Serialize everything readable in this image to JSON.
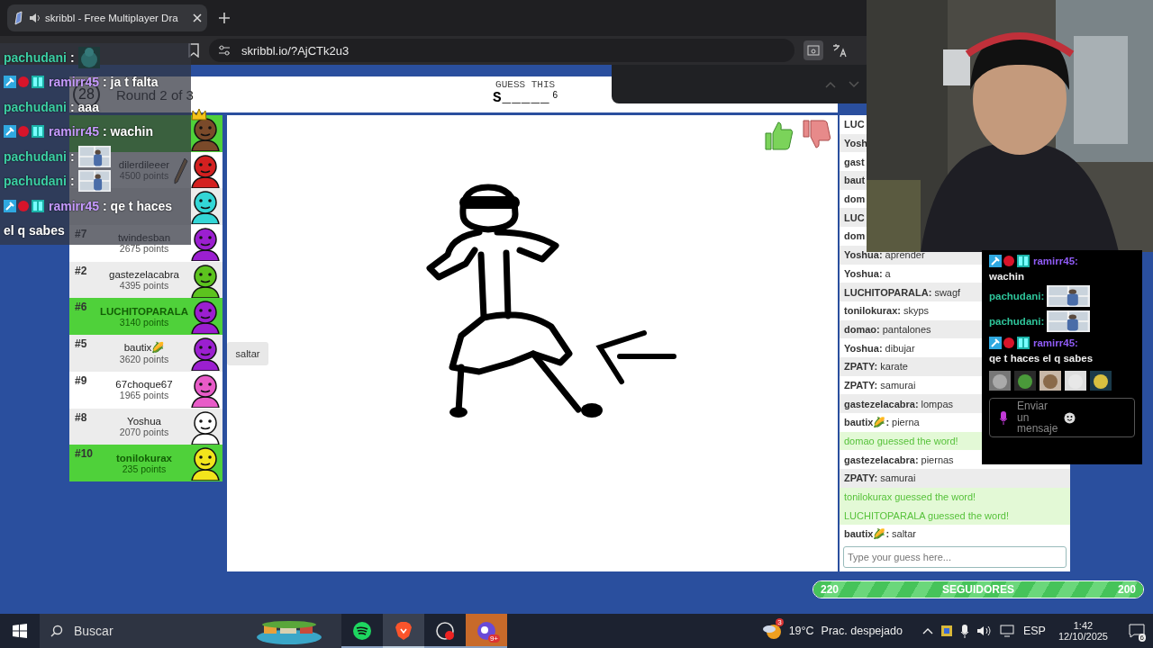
{
  "browser": {
    "tab": {
      "title": "skribbl - Free Multiplayer Dra",
      "selected": true
    },
    "url": "skribbl.io/?AjCTk2u3"
  },
  "stream_chat": [
    {
      "kind": "emote",
      "author": "pachudani",
      "badges": false,
      "text": ":"
    },
    {
      "kind": "text",
      "author": "ramirr45",
      "badges": true,
      "text": ": ja t falta"
    },
    {
      "kind": "text",
      "author": "pachudani",
      "badges": false,
      "text": ": aaa"
    },
    {
      "kind": "text",
      "author": "ramirr45",
      "badges": true,
      "text": ": wachin"
    },
    {
      "author": "pachudani",
      "badges": false,
      "text": ":"
    },
    {
      "author": "pachudani",
      "badges": false,
      "text": ":"
    },
    {
      "kind": "text",
      "author": "ramirr45",
      "badges": true,
      "text": ": qe t haces"
    },
    {
      "kind": "text",
      "badges": false,
      "text": "el q sabes"
    }
  ],
  "game": {
    "timer": "28",
    "round": "Round 2 of 3",
    "hint_label": "GUESS THIS",
    "word": "S_____",
    "word_length": "6"
  },
  "players": [
    {
      "guessed": true,
      "drawing": false,
      "owner": true,
      "color": "#7a4a2a"
    },
    {
      "name": "dilerdileeer",
      "points": "4500 points",
      "guessed": false,
      "drawing": true,
      "owner": false,
      "color": "#d42020"
    },
    {
      "guessed": false,
      "drawing": false,
      "owner": false,
      "color": "#33d6d6"
    },
    {
      "rank": "#7",
      "name": "twindesban",
      "points": "2675 points",
      "guessed": false,
      "drawing": false,
      "owner": false,
      "color": "#9b1fd0"
    },
    {
      "rank": "#2",
      "name": "gastezelacabra",
      "points": "4395 points",
      "guessed": false,
      "drawing": false,
      "owner": false,
      "color": "#5cc31e"
    },
    {
      "rank": "#6",
      "name": "LUCHITOPARALA",
      "points": "3140 points",
      "guessed": true,
      "drawing": false,
      "owner": false,
      "color": "#9b1fd0"
    },
    {
      "rank": "#5",
      "name": "bautix🌽",
      "points": "3620 points",
      "guessed": false,
      "drawing": false,
      "owner": false,
      "color": "#9b1fd0"
    },
    {
      "rank": "#9",
      "name": "67choque67",
      "points": "1965 points",
      "guessed": false,
      "drawing": false,
      "owner": false,
      "color": "#e85bc8"
    },
    {
      "rank": "#8",
      "name": "Yoshua",
      "points": "2070 points",
      "guessed": false,
      "drawing": false,
      "owner": false,
      "color": "#ffffff"
    },
    {
      "rank": "#10",
      "name": "tonilokurax",
      "points": "235 points",
      "guessed": true,
      "drawing": false,
      "owner": false,
      "color": "#f2e41c"
    }
  ],
  "canvas_tooltip": "saltar",
  "chat": [
    {
      "kind": "message",
      "author": "LUC"
    },
    {
      "kind": "message",
      "author": "Yosh"
    },
    {
      "kind": "message",
      "author": "gast"
    },
    {
      "kind": "message",
      "author": "baut"
    },
    {
      "kind": "message",
      "author": "dom"
    },
    {
      "kind": "message",
      "author": "LUC"
    },
    {
      "kind": "message",
      "author": "dom"
    },
    {
      "kind": "message",
      "author": "Yoshua:",
      "text": "aprender"
    },
    {
      "kind": "message",
      "author": "Yoshua:",
      "text": "a"
    },
    {
      "kind": "message",
      "author": "LUCHITOPARALA:",
      "text": "swagf"
    },
    {
      "kind": "message",
      "author": "tonilokurax:",
      "text": "skyps"
    },
    {
      "kind": "message",
      "author": "domao:",
      "text": "pantalones"
    },
    {
      "kind": "message",
      "author": "Yoshua:",
      "text": "dibujar"
    },
    {
      "kind": "message",
      "author": "ZPATY:",
      "text": "karate"
    },
    {
      "kind": "message",
      "author": "ZPATY:",
      "text": "samurai"
    },
    {
      "kind": "message",
      "author": "gastezelacabra:",
      "text": "lompas"
    },
    {
      "kind": "message",
      "author": "bautix🌽:",
      "text": "pierna"
    },
    {
      "kind": "guessed",
      "text": "domao guessed the word!"
    },
    {
      "kind": "message",
      "author": "gastezelacabra:",
      "text": "piernas"
    },
    {
      "kind": "message",
      "author": "ZPATY:",
      "text": "samurai"
    },
    {
      "kind": "guessed",
      "text": "tonilokurax guessed the word!"
    },
    {
      "kind": "guessed",
      "text": "LUCHITOPARALA guessed the word!"
    },
    {
      "kind": "message",
      "author": "bautix🌽:",
      "text": "saltar"
    }
  ],
  "guess_input": {
    "placeholder": "Type your guess here..."
  },
  "twitch_chat": {
    "messages": [
      {
        "kind": "text",
        "author": "ramirr45:",
        "badges": true,
        "text": "wachin"
      },
      {
        "author": "pachudani:",
        "badges": false
      },
      {
        "author": "pachudani:",
        "badges": false
      },
      {
        "kind": "text",
        "author": "ramirr45:",
        "badges": true,
        "text": "qe t haces el q sabes"
      }
    ],
    "input_placeholder": "Enviar un mensaje"
  },
  "follower_goal": {
    "current": "220",
    "label": "SEGUIDORES",
    "target": "200",
    "level": 1
  },
  "taskbar": {
    "search": "Buscar",
    "apps": [
      {
        "kind": "spotify",
        "selected": false
      },
      {
        "kind": "brave",
        "selected": true
      },
      {
        "kind": "obs",
        "selected": false
      },
      {
        "kind": "chat",
        "selected": false,
        "badge": "9+"
      }
    ],
    "weather_badge": "3",
    "temperature": "19°C",
    "weather": "Prac. despejado",
    "language": "ESP",
    "time": "1:42",
    "date": "12/10/2025",
    "notifications": "6"
  }
}
